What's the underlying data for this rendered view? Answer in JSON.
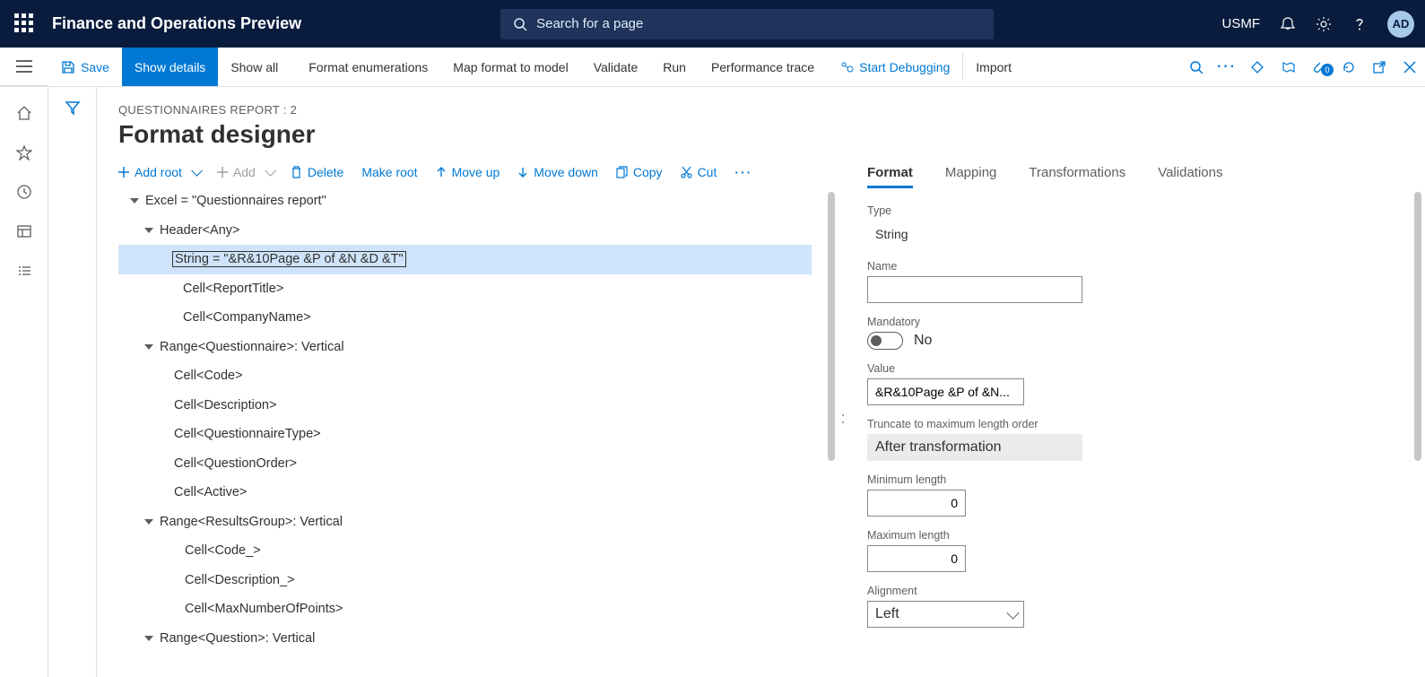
{
  "header": {
    "brand": "Finance and Operations Preview",
    "search_placeholder": "Search for a page",
    "company": "USMF",
    "avatar": "AD"
  },
  "actions": {
    "save": "Save",
    "show_details": "Show details",
    "show_all": "Show all",
    "format_enum": "Format enumerations",
    "map_format": "Map format to model",
    "validate": "Validate",
    "run": "Run",
    "perf_trace": "Performance trace",
    "start_debug": "Start Debugging",
    "import": "Import",
    "badge_count": "0"
  },
  "page": {
    "crumb": "QUESTIONNAIRES REPORT : 2",
    "title": "Format designer"
  },
  "left_toolbar": {
    "add_root": "Add root",
    "add": "Add",
    "delete": "Delete",
    "make_root": "Make root",
    "move_up": "Move up",
    "move_down": "Move down",
    "copy": "Copy",
    "cut": "Cut"
  },
  "tree": [
    {
      "indent": 0,
      "tw": true,
      "label": "Excel = \"Questionnaires report\""
    },
    {
      "indent": 1,
      "tw": true,
      "label": "Header<Any>"
    },
    {
      "indent": 2,
      "tw": false,
      "sel": true,
      "label": "String = \"&R&10Page &P of &N &D &T\""
    },
    {
      "indent": 2,
      "tw": false,
      "label": "Cell<ReportTitle>",
      "cell": true
    },
    {
      "indent": 2,
      "tw": false,
      "label": "Cell<CompanyName>",
      "cell": true
    },
    {
      "indent": 1,
      "tw": true,
      "label": "Range<Questionnaire>: Vertical"
    },
    {
      "indent": 2,
      "tw": false,
      "label": "Cell<Code>"
    },
    {
      "indent": 2,
      "tw": false,
      "label": "Cell<Description>"
    },
    {
      "indent": 2,
      "tw": false,
      "label": "Cell<QuestionnaireType>"
    },
    {
      "indent": 2,
      "tw": false,
      "label": "Cell<QuestionOrder>"
    },
    {
      "indent": 2,
      "tw": false,
      "label": "Cell<Active>"
    },
    {
      "indent": 2,
      "tw": true,
      "off": true,
      "label": "Range<ResultsGroup>: Vertical"
    },
    {
      "indent": 3,
      "tw": false,
      "label": "Cell<Code_>"
    },
    {
      "indent": 3,
      "tw": false,
      "label": "Cell<Description_>"
    },
    {
      "indent": 3,
      "tw": false,
      "label": "Cell<MaxNumberOfPoints>"
    },
    {
      "indent": 2,
      "tw": true,
      "off": true,
      "label": "Range<Question>: Vertical"
    }
  ],
  "tabs": {
    "format": "Format",
    "mapping": "Mapping",
    "transformations": "Transformations",
    "validations": "Validations"
  },
  "form": {
    "type_label": "Type",
    "type_value": "String",
    "name_label": "Name",
    "name_value": "",
    "mandatory_label": "Mandatory",
    "mandatory_value": "No",
    "value_label": "Value",
    "value_value": "&R&10Page &P of &N...",
    "trunc_label": "Truncate to maximum length order",
    "trunc_value": "After transformation",
    "minlen_label": "Minimum length",
    "minlen_value": "0",
    "maxlen_label": "Maximum length",
    "maxlen_value": "0",
    "align_label": "Alignment",
    "align_value": "Left"
  }
}
